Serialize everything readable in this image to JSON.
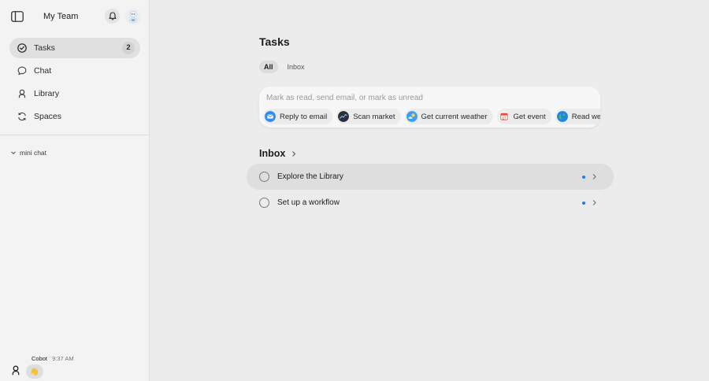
{
  "sidebar": {
    "title": "My Team",
    "nav": [
      {
        "label": "Tasks",
        "icon": "check-circle-icon",
        "count": "2",
        "active": true
      },
      {
        "label": "Chat",
        "icon": "chat-bubble-icon"
      },
      {
        "label": "Library",
        "icon": "person-icon"
      },
      {
        "label": "Spaces",
        "icon": "refresh-icon"
      }
    ],
    "mini_chat": "mini chat",
    "message": {
      "author": "Cobot",
      "time": "9:37 AM",
      "reaction": "👋"
    }
  },
  "main": {
    "title": "Tasks",
    "tabs": [
      {
        "label": "All",
        "active": true
      },
      {
        "label": "Inbox"
      }
    ],
    "compose": {
      "placeholder": "Mark as read, send email, or mark as unread",
      "chips": [
        {
          "label": "Reply to email",
          "icon": "mail-icon",
          "color": "#2f8cf0"
        },
        {
          "label": "Scan market",
          "icon": "chart-icon",
          "color": "#2b2f3a"
        },
        {
          "label": "Get current weather",
          "icon": "weather-icon",
          "color": "#3aa0f5"
        },
        {
          "label": "Get event",
          "icon": "calendar-icon",
          "color": "#e8453c"
        },
        {
          "label": "Read web page",
          "icon": "globe-icon",
          "color": "#1f88e0"
        }
      ]
    },
    "inbox": {
      "title": "Inbox",
      "items": [
        {
          "label": "Explore the Library",
          "unread": true,
          "highlighted": true
        },
        {
          "label": "Set up a workflow",
          "unread": true
        }
      ]
    }
  },
  "colors": {
    "accent": "#1a7ff2",
    "sidebar_bg": "#f3f3f3",
    "main_bg": "#ececec"
  }
}
